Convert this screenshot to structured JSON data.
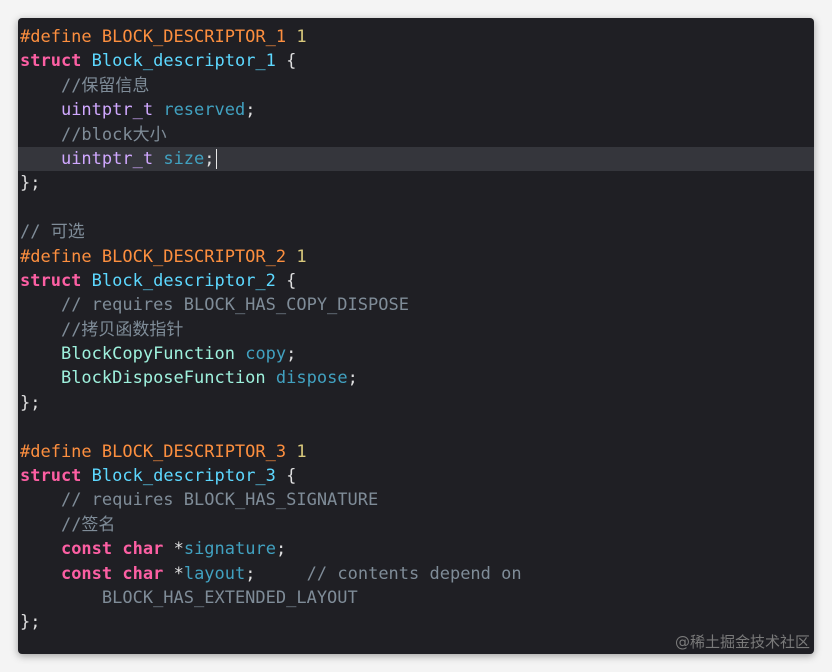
{
  "editor": {
    "lines": [
      [
        {
          "c": "pp",
          "t": "#define BLOCK_DESCRIPTOR_1 "
        },
        {
          "c": "num",
          "t": "1"
        }
      ],
      [
        {
          "c": "kw",
          "t": "struct"
        },
        {
          "c": "plain",
          "t": " "
        },
        {
          "c": "type",
          "t": "Block_descriptor_1"
        },
        {
          "c": "plain",
          "t": " {"
        }
      ],
      [
        {
          "c": "plain",
          "t": "    "
        },
        {
          "c": "cmt",
          "t": "//保留信息"
        }
      ],
      [
        {
          "c": "plain",
          "t": "    "
        },
        {
          "c": "ptype",
          "t": "uintptr_t"
        },
        {
          "c": "plain",
          "t": " "
        },
        {
          "c": "ident",
          "t": "reserved"
        },
        {
          "c": "plain",
          "t": ";"
        }
      ],
      [
        {
          "c": "plain",
          "t": "    "
        },
        {
          "c": "cmt",
          "t": "//block大小"
        }
      ],
      [
        {
          "c": "plain",
          "t": "    "
        },
        {
          "c": "ptype",
          "t": "uintptr_t"
        },
        {
          "c": "plain",
          "t": " "
        },
        {
          "c": "ident",
          "t": "size"
        },
        {
          "c": "plain",
          "t": ";"
        }
      ],
      [
        {
          "c": "plain",
          "t": "};"
        }
      ],
      [],
      [
        {
          "c": "cmt",
          "t": "// 可选"
        }
      ],
      [
        {
          "c": "pp",
          "t": "#define BLOCK_DESCRIPTOR_2 "
        },
        {
          "c": "num",
          "t": "1"
        }
      ],
      [
        {
          "c": "kw",
          "t": "struct"
        },
        {
          "c": "plain",
          "t": " "
        },
        {
          "c": "type",
          "t": "Block_descriptor_2"
        },
        {
          "c": "plain",
          "t": " {"
        }
      ],
      [
        {
          "c": "plain",
          "t": "    "
        },
        {
          "c": "cmt",
          "t": "// requires BLOCK_HAS_COPY_DISPOSE"
        }
      ],
      [
        {
          "c": "plain",
          "t": "    "
        },
        {
          "c": "cmt",
          "t": "//拷贝函数指针"
        }
      ],
      [
        {
          "c": "plain",
          "t": "    "
        },
        {
          "c": "ftype",
          "t": "BlockCopyFunction"
        },
        {
          "c": "plain",
          "t": " "
        },
        {
          "c": "ident",
          "t": "copy"
        },
        {
          "c": "plain",
          "t": ";"
        }
      ],
      [
        {
          "c": "plain",
          "t": "    "
        },
        {
          "c": "ftype",
          "t": "BlockDisposeFunction"
        },
        {
          "c": "plain",
          "t": " "
        },
        {
          "c": "ident",
          "t": "dispose"
        },
        {
          "c": "plain",
          "t": ";"
        }
      ],
      [
        {
          "c": "plain",
          "t": "};"
        }
      ],
      [],
      [
        {
          "c": "pp",
          "t": "#define BLOCK_DESCRIPTOR_3 "
        },
        {
          "c": "num",
          "t": "1"
        }
      ],
      [
        {
          "c": "kw",
          "t": "struct"
        },
        {
          "c": "plain",
          "t": " "
        },
        {
          "c": "type",
          "t": "Block_descriptor_3"
        },
        {
          "c": "plain",
          "t": " {"
        }
      ],
      [
        {
          "c": "plain",
          "t": "    "
        },
        {
          "c": "cmt",
          "t": "// requires BLOCK_HAS_SIGNATURE"
        }
      ],
      [
        {
          "c": "plain",
          "t": "    "
        },
        {
          "c": "cmt",
          "t": "//签名"
        }
      ],
      [
        {
          "c": "plain",
          "t": "    "
        },
        {
          "c": "kw",
          "t": "const"
        },
        {
          "c": "plain",
          "t": " "
        },
        {
          "c": "kw",
          "t": "char"
        },
        {
          "c": "plain",
          "t": " *"
        },
        {
          "c": "ident",
          "t": "signature"
        },
        {
          "c": "plain",
          "t": ";"
        }
      ],
      [
        {
          "c": "plain",
          "t": "    "
        },
        {
          "c": "kw",
          "t": "const"
        },
        {
          "c": "plain",
          "t": " "
        },
        {
          "c": "kw",
          "t": "char"
        },
        {
          "c": "plain",
          "t": " *"
        },
        {
          "c": "ident",
          "t": "layout"
        },
        {
          "c": "plain",
          "t": ";     "
        },
        {
          "c": "cmt",
          "t": "// contents depend on"
        }
      ],
      [
        {
          "c": "plain",
          "t": "        "
        },
        {
          "c": "cmt",
          "t": "BLOCK_HAS_EXTENDED_LAYOUT"
        }
      ],
      [
        {
          "c": "plain",
          "t": "};"
        }
      ]
    ],
    "current_line": 6
  },
  "watermark": "@稀土掘金技术社区",
  "colors": {
    "background": "#1f1f24",
    "preprocessor": "#fd8f3f",
    "number": "#d9c97c",
    "keyword": "#fc5fa3",
    "type": "#5dd8ff",
    "comment": "#7f8c98",
    "current_line": "#35363c"
  }
}
